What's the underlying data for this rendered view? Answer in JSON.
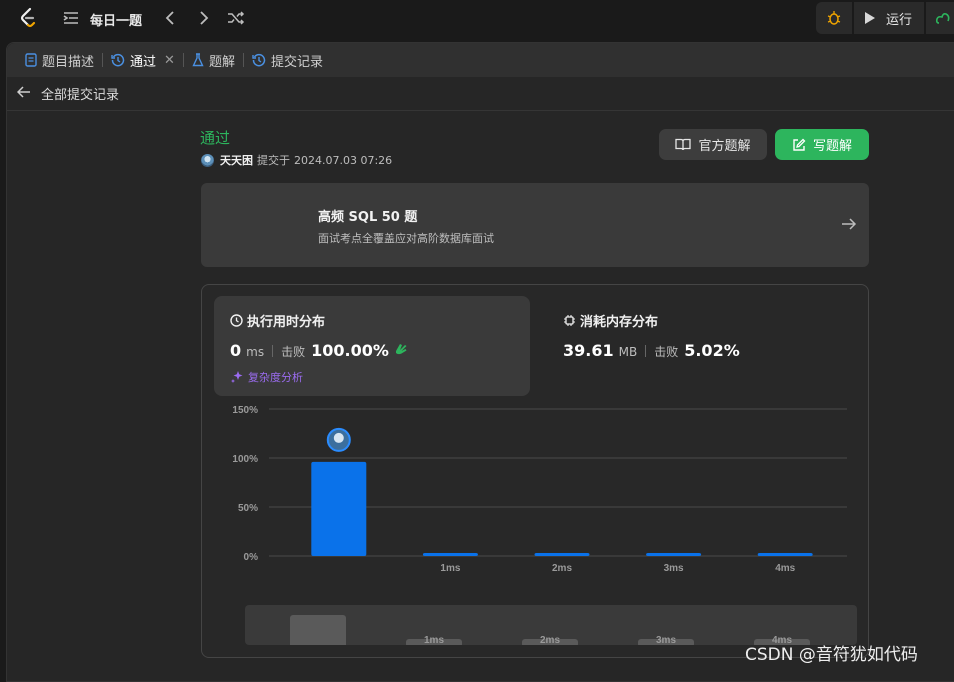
{
  "topbar": {
    "daily_label": "每日一题",
    "run_label": "运行"
  },
  "tabs": {
    "description": "题目描述",
    "passed": "通过",
    "solutions": "题解",
    "submissions": "提交记录"
  },
  "breadcrumb": {
    "back_label": "全部提交记录"
  },
  "submission": {
    "status": "通过",
    "user": "天天困",
    "submitted_prefix": "提交于",
    "datetime": "2024.07.03 07:26"
  },
  "buttons": {
    "official_solution": "官方题解",
    "write_solution": "写题解"
  },
  "study_plan": {
    "title": "高频 SQL 50 题",
    "subtitle": "面试考点全覆盖应对高阶数据库面试"
  },
  "runtime": {
    "title": "执行用时分布",
    "value": "0",
    "unit": "ms",
    "beats_label": "击败",
    "beats_value": "100.00%",
    "complexity_link": "复杂度分析"
  },
  "memory": {
    "title": "消耗内存分布",
    "value": "39.61",
    "unit": "MB",
    "beats_label": "击败",
    "beats_value": "5.02%"
  },
  "colors": {
    "accent_green": "#2db55d",
    "bar_blue": "#0a72ea",
    "complexity_purple": "#9b6cf0"
  },
  "chart_data": {
    "type": "bar",
    "categories": [
      "",
      "1ms",
      "2ms",
      "3ms",
      "4ms"
    ],
    "values": [
      96,
      3,
      3,
      3,
      3
    ],
    "y_ticks": [
      "0%",
      "50%",
      "100%",
      "150%"
    ],
    "ylim": [
      0,
      150
    ],
    "grid": true
  },
  "minimap": {
    "labels": [
      "1ms",
      "2ms",
      "3ms",
      "4ms"
    ]
  },
  "watermark": "CSDN @音符犹如代码"
}
